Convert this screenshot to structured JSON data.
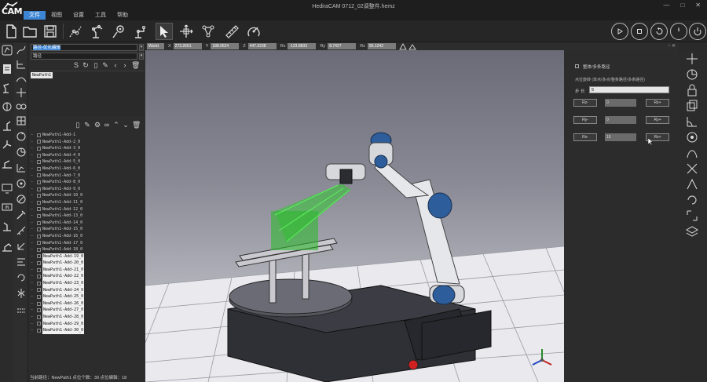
{
  "app": {
    "logo_text": "CAM",
    "window_title": "HediraCAM   0712_02调整件.hemz",
    "menu": [
      "文件",
      "视图",
      "设置",
      "工具",
      "帮助"
    ],
    "window_controls": [
      "—",
      "□",
      "✕"
    ]
  },
  "toolbar": {
    "icons": [
      "new-file-icon",
      "open-folder-icon",
      "save-icon",
      "robot-path-icon",
      "robot-arm-icon",
      "robot-gear-icon",
      "robot-tool-icon",
      "select-cursor-icon",
      "move-axes-icon",
      "robot-link-icon",
      "ruler-icon",
      "calibrate-icon"
    ],
    "right_circle_icons": [
      "play-icon",
      "stop-icon",
      "rotate-left-icon",
      "gauge-icon",
      "power-icon"
    ]
  },
  "left_panel": {
    "dropdown1": "路径-优化编辑",
    "dropdown2": "路径",
    "tree_root": "NewPath1",
    "path_items": [
      "NewPath1-Add-1",
      "NewPath1-Add-2_0",
      "NewPath1-Add-3_0",
      "NewPath1-Add-4_0",
      "NewPath1-Add-5_0",
      "NewPath1-Add-6_0",
      "NewPath1-Add-7_0",
      "NewPath1-Add-8_0",
      "NewPath1-Add-9_0",
      "NewPath1-Add-10_0",
      "NewPath1-Add-11_0",
      "NewPath1-Add-12_0",
      "NewPath1-Add-13_0",
      "NewPath1-Add-14_0",
      "NewPath1-Add-15_0",
      "NewPath1-Add-16_0",
      "NewPath1-Add-17_0",
      "NewPath1-Add-18_0",
      "NewPath1-Add-19_0",
      "NewPath1-Add-20_0",
      "NewPath1-Add-21_0",
      "NewPath1-Add-22_0",
      "NewPath1-Add-23_0",
      "NewPath1-Add-24_0",
      "NewPath1-Add-25_0",
      "NewPath1-Add-26_0",
      "NewPath1-Add-27_0",
      "NewPath1-Add-28_0",
      "NewPath1-Add-29_0",
      "NewPath1-Add-30_0"
    ],
    "selected_from_index": 18,
    "status": "当前路径：NewPath1   点位个数：30   点位编辑：18"
  },
  "coord_bar": {
    "frame": "World",
    "fields": [
      {
        "label": "X",
        "value": "273.2661"
      },
      {
        "label": "Y",
        "value": "188.0624"
      },
      {
        "label": "Z",
        "value": "447.0238"
      },
      {
        "label": "Rx",
        "value": "-123.8833"
      },
      {
        "label": "Ry",
        "value": "8.7427"
      },
      {
        "label": "Rz",
        "value": "95.1242"
      }
    ]
  },
  "right_panel": {
    "checkbox_label": "整体/多条路径",
    "section_label": "点位旋转    (单点/多点/整条路径/多条路径)",
    "step_label": "步 长",
    "step_value": "5",
    "rows": [
      {
        "minus": "Rz-",
        "value": "0",
        "plus": "Rz+"
      },
      {
        "minus": "Ry-",
        "value": "0",
        "plus": "Ry+"
      },
      {
        "minus": "Rx-",
        "value": "15",
        "plus": "Rx+"
      }
    ]
  }
}
